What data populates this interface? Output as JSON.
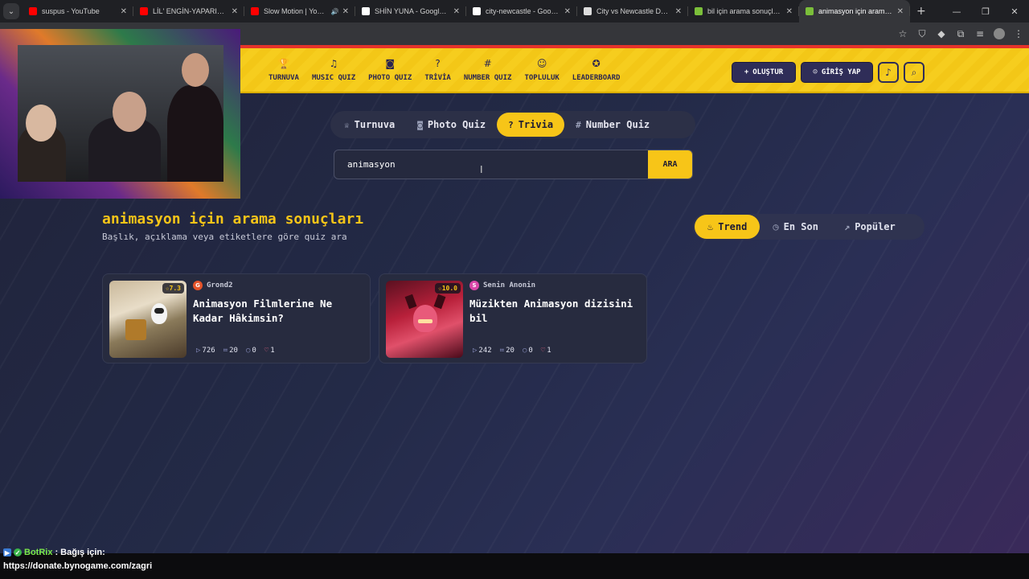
{
  "browser": {
    "tabs": [
      {
        "title": "suspus - YouTube",
        "color": "#ff0000",
        "audio": false,
        "active": false
      },
      {
        "title": "LİL' ENGİN-YAPARIM DE...",
        "color": "#ff0000",
        "audio": false,
        "active": false
      },
      {
        "title": "Slow Motion | YouTub...",
        "color": "#ff0000",
        "audio": true,
        "active": false
      },
      {
        "title": "SHİN YUNA - Google'da A...",
        "color": "#ffffff",
        "audio": false,
        "active": false
      },
      {
        "title": "city-newcastle - Google'd...",
        "color": "#ffffff",
        "audio": false,
        "active": false
      },
      {
        "title": "City vs Newcastle Değerle...",
        "color": "#dddddd",
        "audio": false,
        "active": false
      },
      {
        "title": "bil için arama sonuçları -...",
        "color": "#7bbf3a",
        "audio": false,
        "active": false
      },
      {
        "title": "animasyon için arama son...",
        "color": "#7bbf3a",
        "audio": false,
        "active": true
      }
    ]
  },
  "nav": {
    "items": [
      {
        "icon": "trophy-icon",
        "glyph": "🏆",
        "label": "TURNUVA"
      },
      {
        "icon": "music-icon",
        "glyph": "♫",
        "label": "MUSIC QUIZ"
      },
      {
        "icon": "camera-icon",
        "glyph": "◙",
        "label": "PHOTO QUIZ"
      },
      {
        "icon": "question-icon",
        "glyph": "?",
        "label": "TRİVİA"
      },
      {
        "icon": "hash-icon",
        "glyph": "#",
        "label": "NUMBER QUIZ"
      },
      {
        "icon": "users-icon",
        "glyph": "☺",
        "label": "TOPLULUK"
      },
      {
        "icon": "medal-icon",
        "glyph": "✪",
        "label": "LEADERBOARD"
      }
    ],
    "create_label": "OLUŞTUR",
    "login_label": "GİRİŞ YAP"
  },
  "mode_tabs": [
    {
      "icon": "trophy-icon",
      "glyph": "♕",
      "label": "Turnuva",
      "active": false
    },
    {
      "icon": "camera-icon",
      "glyph": "◙",
      "label": "Photo Quiz",
      "active": false
    },
    {
      "icon": "question-icon",
      "glyph": "?",
      "label": "Trivia",
      "active": true
    },
    {
      "icon": "hash-icon",
      "glyph": "#",
      "label": "Number Quiz",
      "active": false
    }
  ],
  "search": {
    "value": "animasyon",
    "button_label": "ARA"
  },
  "results": {
    "title": "animasyon için arama sonuçları",
    "subtitle": "Başlık, açıklama veya etiketlere göre quiz ara"
  },
  "sort_tabs": [
    {
      "icon": "flame-icon",
      "glyph": "♨",
      "label": "Trend",
      "active": true
    },
    {
      "icon": "clock-icon",
      "glyph": "◷",
      "label": "En Son",
      "active": false
    },
    {
      "icon": "trending-icon",
      "glyph": "↗",
      "label": "Popüler",
      "active": false
    }
  ],
  "cards": [
    {
      "rating": "☆7.3",
      "author_initial": "G",
      "author": "Grond2",
      "author_color": "#e5532a",
      "title": "Animasyon Filmlerine Ne Kadar Hâkimsin?",
      "plays": "726",
      "questions": "20",
      "comments": "0",
      "likes": "1"
    },
    {
      "rating": "☆10.0",
      "author_initial": "S",
      "author": "Senin Anonin",
      "author_color": "#d946a8",
      "title": "Müzikten Animasyon dizisini bil",
      "plays": "242",
      "questions": "20",
      "comments": "0",
      "likes": "1"
    }
  ],
  "overlay": {
    "bot_name": "BotRix",
    "bot_text": ": Bağış için:",
    "donate_url": "https://donate.bynogame.com/zagri"
  }
}
